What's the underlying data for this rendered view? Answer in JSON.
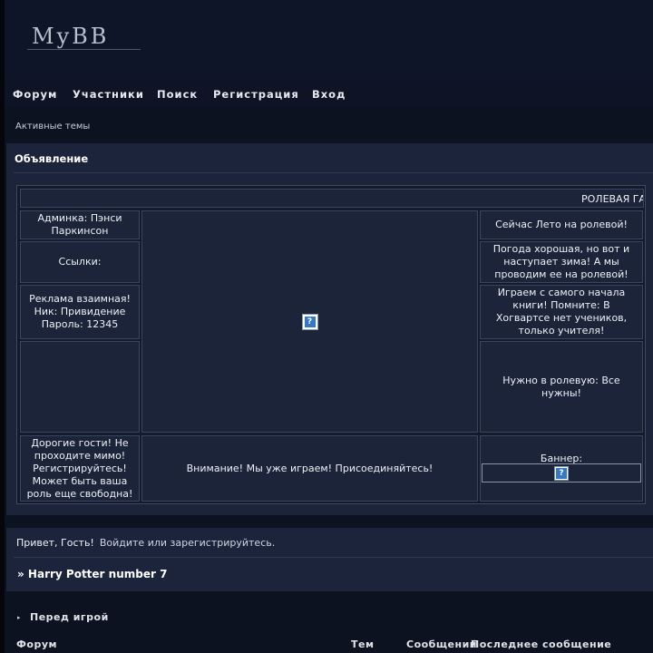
{
  "header": {
    "logo_text": "MyBB"
  },
  "nav": {
    "items": [
      "Форум",
      "Участники",
      "Поиск",
      "Регистрация",
      "Вход"
    ]
  },
  "subnav": {
    "active_topics": "Активные темы"
  },
  "announcement": {
    "title": "Объявление",
    "marquee": "РОЛЕВАЯ ГА",
    "left": [
      "Админка: Пэнси Паркинсон",
      "Ссылки:",
      "Реклама взаимная! Ник: Привидение Пароль: 12345",
      "",
      "Дорогие гости! Не проходите мимо! Регистрируйтесь! Может быть ваша роль еще свободна!"
    ],
    "center_bottom": "Внимание! Мы уже играем! Присоединяйтесь!",
    "right": [
      "Сейчас Лето на ролевой!",
      "Погода хорошая, но вот и наступает зима! А мы проводим ее на ролевой!",
      "Играем с самого начала книги! Помните: В Хогвартсе нет учеников, только учителя!",
      "Нужно в ролевую: Все нужны!"
    ],
    "banner_label": "Баннер:",
    "image_glyph": "?"
  },
  "welcome": {
    "greeting": "Привет, Гость!",
    "login_text": "Войдите или зарегистрируйтесь.",
    "forum_name": "» Harry Potter number 7"
  },
  "category": {
    "arrow": "▸",
    "title": "Перед игрой",
    "columns": [
      "Форум",
      "Тем",
      "Сообщений",
      "Последнее сообщение"
    ]
  }
}
